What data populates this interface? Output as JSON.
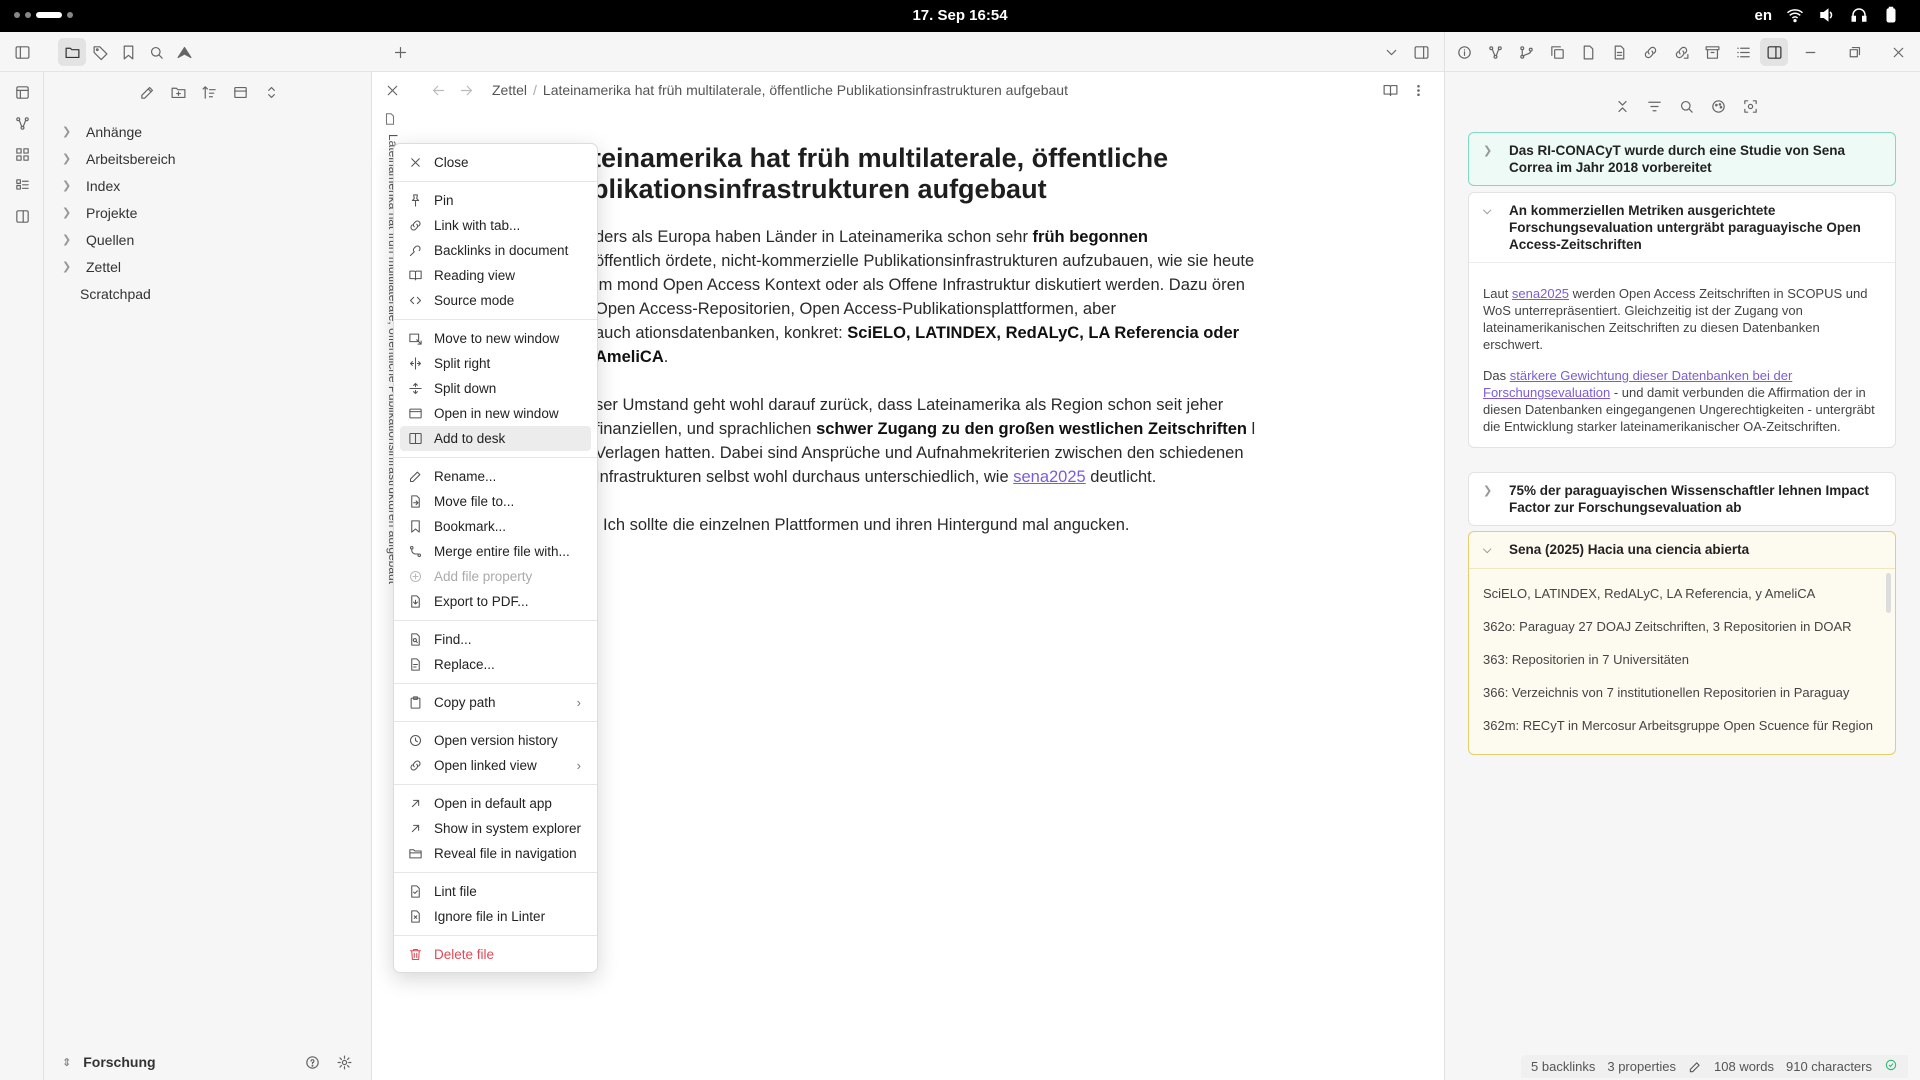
{
  "system": {
    "clock": "17. Sep  16:54",
    "lang": "en"
  },
  "ribbon_icons": [
    "files-icon",
    "graph-icon",
    "canvas-icon",
    "kanban-icon",
    "sidebar-icon"
  ],
  "left_toolbar_icons": [
    "sidebar-toggle-icon",
    "folder-icon",
    "tag-icon",
    "bookmark-icon",
    "search-icon",
    "home-icon"
  ],
  "explorer": {
    "actions": [
      "new-note-icon",
      "new-folder-icon",
      "sort-icon",
      "collapse-icon",
      "expand-icon"
    ],
    "items": [
      {
        "label": "Anhänge",
        "folder": true
      },
      {
        "label": "Arbeitsbereich",
        "folder": true
      },
      {
        "label": "Index",
        "folder": true
      },
      {
        "label": "Projekte",
        "folder": true
      },
      {
        "label": "Quellen",
        "folder": true
      },
      {
        "label": "Zettel",
        "folder": true
      },
      {
        "label": "Scratchpad",
        "folder": false
      }
    ],
    "vault_name": "Forschung"
  },
  "editor": {
    "breadcrumb_folder": "Zettel",
    "breadcrumb_title": "Lateinamerika hat früh multilaterale, öffentliche Publikationsinfrastrukturen aufgebaut",
    "vertical_tab_title": "Lateinamerika hat früh multilaterale, öffentliche Publikationsinfrastrukturen aufgebaut",
    "title_line1": "teinamerika hat früh multilaterale, öffentliche",
    "title_line2": "blikationsinfrastrukturen aufgebaut",
    "p1_a": "ders als Europa haben Länder in Lateinamerika schon sehr ",
    "p1_b": "früh begonnen",
    "p1_c": " öffentlich ördete, nicht-kommerzielle Publikationsinfrastrukturen aufzubauen, wie sie heute im mond Open Access Kontext oder als Offene Infrastruktur diskutiert werden. Dazu ören Open Access-Repositorien, Open Access-Publikationsplattformen, aber auch ationsdatenbanken, konkret: ",
    "p1_d": "SciELO, LATINDEX, RedALyC, LA Referencia oder AmeliCA",
    "p1_e": ".",
    "p2_a": "ser Umstand geht wohl darauf zurück, dass Lateinamerika als Region schon seit jeher  finanziellen, und sprachlichen ",
    "p2_b": "schwer Zugang zu den großen westlichen Zeitschriften",
    "p2_c": " l Verlagen hatten. Dabei sind Ansprüche und Aufnahmekriterien zwischen den schiedenen Infrastrukturen selbst wohl durchaus unterschiedlich, wie ",
    "p2_link": "sena2025",
    "p2_d": " deutlicht.",
    "p3": "Ich sollte die einzelnen Plattformen und ihren Hintergund mal angucken."
  },
  "context_menu": {
    "groups": [
      [
        {
          "label": "Close",
          "icon": "close-icon"
        }
      ],
      [
        {
          "label": "Pin",
          "icon": "pin-icon"
        },
        {
          "label": "Link with tab...",
          "icon": "link-icon"
        },
        {
          "label": "Backlinks in document",
          "icon": "backlinks-icon"
        },
        {
          "label": "Reading view",
          "icon": "book-icon"
        },
        {
          "label": "Source mode",
          "icon": "code-icon"
        }
      ],
      [
        {
          "label": "Move to new window",
          "icon": "window-move-icon"
        },
        {
          "label": "Split right",
          "icon": "split-right-icon"
        },
        {
          "label": "Split down",
          "icon": "split-down-icon"
        },
        {
          "label": "Open in new window",
          "icon": "new-window-icon"
        },
        {
          "label": "Add to desk",
          "icon": "desk-icon",
          "hover": true
        }
      ],
      [
        {
          "label": "Rename...",
          "icon": "pencil-icon"
        },
        {
          "label": "Move file to...",
          "icon": "move-file-icon"
        },
        {
          "label": "Bookmark...",
          "icon": "bookmark-icon"
        },
        {
          "label": "Merge entire file with...",
          "icon": "merge-icon"
        },
        {
          "label": "Add file property",
          "icon": "plus-circle-icon",
          "disabled": true
        },
        {
          "label": "Export to PDF...",
          "icon": "pdf-icon"
        }
      ],
      [
        {
          "label": "Find...",
          "icon": "find-icon"
        },
        {
          "label": "Replace...",
          "icon": "replace-icon"
        }
      ],
      [
        {
          "label": "Copy path",
          "icon": "clipboard-icon",
          "submenu": true
        }
      ],
      [
        {
          "label": "Open version history",
          "icon": "history-icon"
        },
        {
          "label": "Open linked view",
          "icon": "link-icon",
          "submenu": true
        }
      ],
      [
        {
          "label": "Open in default app",
          "icon": "external-icon"
        },
        {
          "label": "Show in system explorer",
          "icon": "external-icon"
        },
        {
          "label": "Reveal file in navigation",
          "icon": "folder-open-icon"
        }
      ],
      [
        {
          "label": "Lint file",
          "icon": "lint-icon"
        },
        {
          "label": "Ignore file in Linter",
          "icon": "ignore-icon"
        }
      ],
      [
        {
          "label": "Delete file",
          "icon": "trash-icon",
          "danger": true
        }
      ]
    ]
  },
  "right_pane": {
    "card1": {
      "title": "Das RI-CONACyT wurde durch eine Studie von Sena Correa im Jahr 2018 vorbereitet",
      "expanded": false
    },
    "card2": {
      "title": "An kommerziellen Metriken ausgerichtete Forschungsevaluation untergräbt paraguayische Open Access-Zeitschriften",
      "b1_pre": "Laut ",
      "b1_link": "sena2025",
      "b1_post": " werden Open Access Zeitschriften in SCOPUS und WoS unterrepräsentiert. Gleichzeitig ist der Zugang von lateinamerikanischen Zeitschriften zu diesen Datenbanken erschwert.",
      "b2_pre": "Das ",
      "b2_link": "stärkere Gewichtung dieser Datenbanken bei der Forschungsevaluation",
      "b2_post": " - und damit verbunden die Affirmation der in diesen Datenbanken eingegangenen Ungerechtigkeiten - untergräbt die Entwicklung starker lateinamerikanischer OA-Zeitschriften."
    },
    "card3": {
      "title": "75% der paraguayischen Wissenschaftler lehnen Impact Factor zur Forschungsevaluation ab",
      "expanded": false
    },
    "card4": {
      "title": "Sena (2025) Hacia una ciencia abierta",
      "lines": [
        "SciELO, LATINDEX, RedALyC, LA Referencia, y AmeliCA",
        "362o: Paraguay 27 DOAJ Zeitschriften, 3 Repositorien in DOAR",
        "363: Repositorien in 7 Universitäten",
        "366: Verzeichnis von 7 institutionellen Repositorien in Paraguay",
        "362m: RECyT in Mercosur Arbeitsgruppe Open Scuence für Region"
      ]
    }
  },
  "status": {
    "backlinks": "5 backlinks",
    "properties": "3 properties",
    "words": "108 words",
    "characters": "910 characters"
  }
}
